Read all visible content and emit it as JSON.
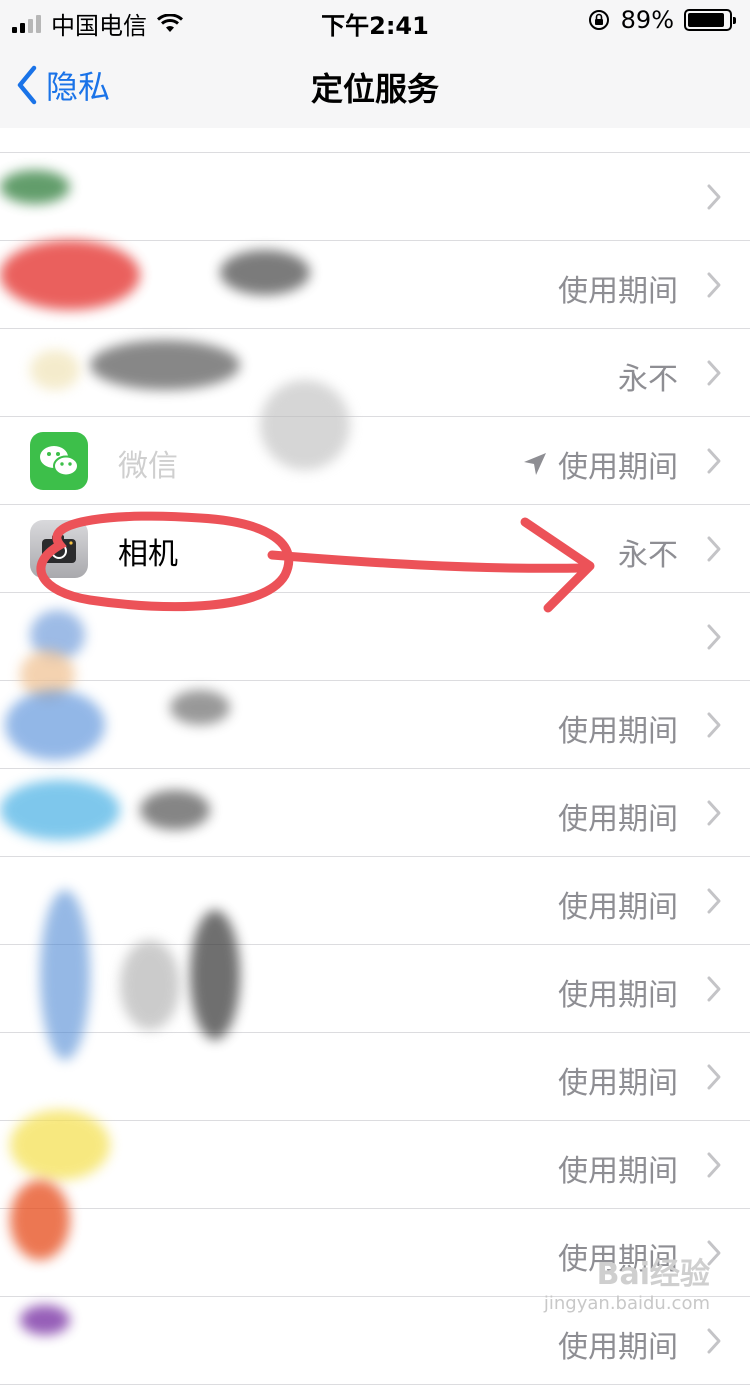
{
  "status_bar": {
    "carrier": "中国电信",
    "time": "下午2:41",
    "battery_percent_text": "89%",
    "battery_level": 0.89,
    "signal_bars": 4,
    "signal_active": 2,
    "icons": [
      "wifi-icon",
      "rotation-lock-icon",
      "battery-icon"
    ]
  },
  "nav": {
    "back_label": "隐私",
    "title": "定位服务"
  },
  "rows": [
    {
      "name": "",
      "status": ""
    },
    {
      "name": "",
      "status": "使用期间"
    },
    {
      "name": "",
      "status": "永不"
    },
    {
      "name": "微信",
      "status": "使用期间",
      "location_arrow": true
    },
    {
      "name": "相机",
      "status": "永不"
    },
    {
      "name": "",
      "status": ""
    },
    {
      "name": "",
      "status": "使用期间"
    },
    {
      "name": "",
      "status": "使用期间"
    },
    {
      "name": "",
      "status": "使用期间"
    },
    {
      "name": "",
      "status": "使用期间"
    },
    {
      "name": "",
      "status": "使用期间"
    },
    {
      "name": "",
      "status": "使用期间"
    },
    {
      "name": "",
      "status": "使用期间"
    },
    {
      "name": "",
      "status": "使用期间"
    }
  ],
  "watermark": {
    "brand": "Bai经验",
    "url": "jingyan.baidu.com"
  },
  "colors": {
    "accent": "#1a73e8",
    "annotation": "#ec5258",
    "secondary_text": "#8e8e93"
  }
}
